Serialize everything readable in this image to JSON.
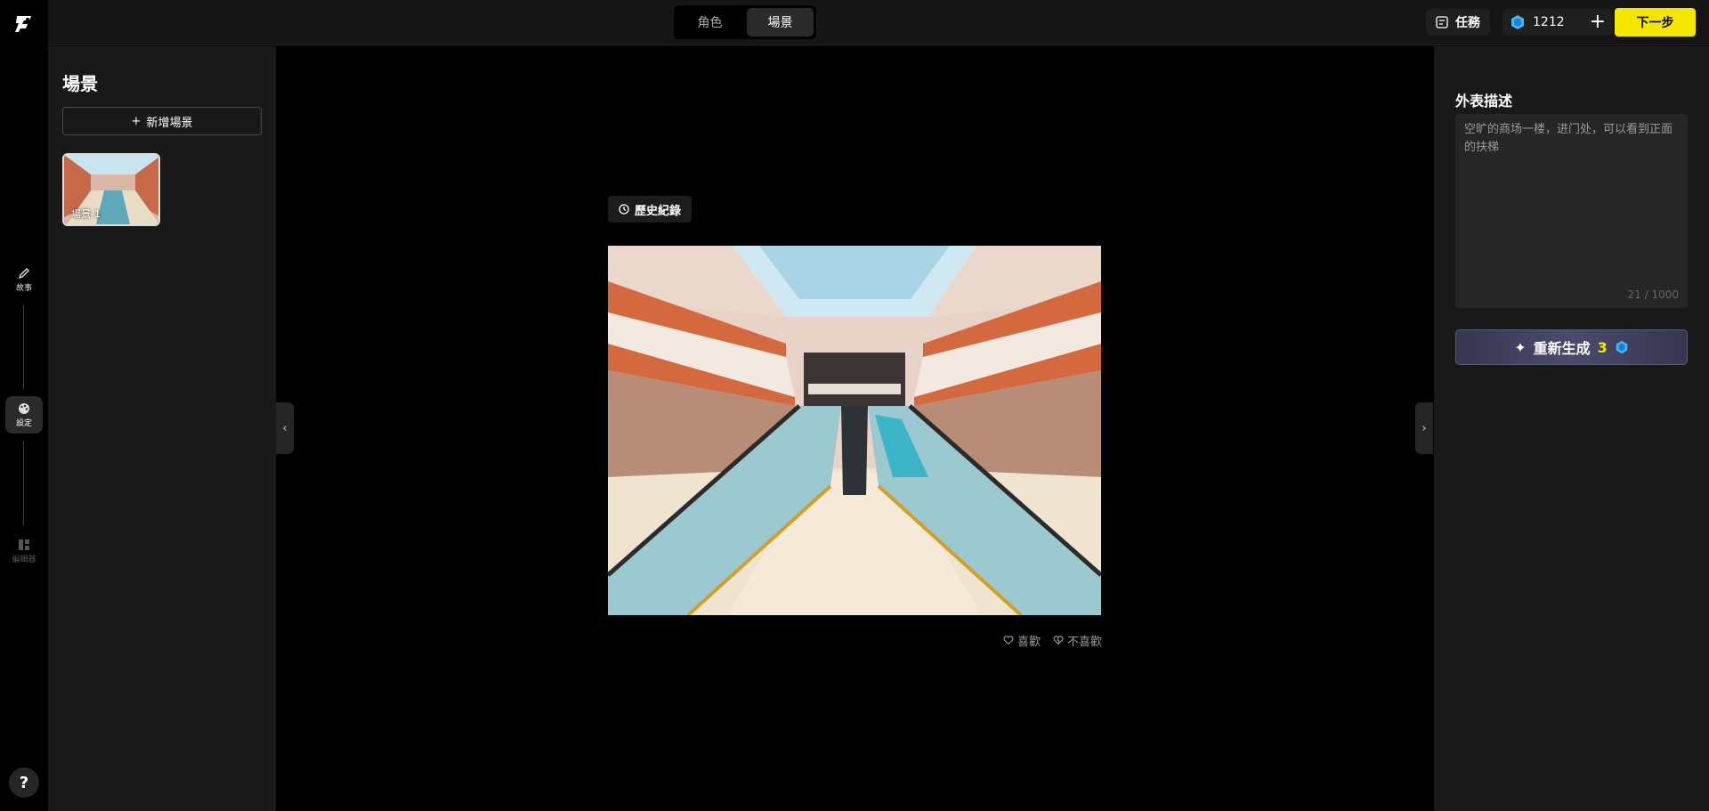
{
  "rail": {
    "items": [
      {
        "label": "故事"
      },
      {
        "label": "設定"
      },
      {
        "label": "編輯器"
      }
    ],
    "help": "?"
  },
  "topbar": {
    "tabs": [
      {
        "label": "角色"
      },
      {
        "label": "場景"
      }
    ],
    "task_label": "任務",
    "credits": "1212",
    "next_label": "下一步"
  },
  "left_panel": {
    "title": "場景",
    "add_label": "新增場景",
    "scenes": [
      {
        "label": "場景-1"
      }
    ]
  },
  "canvas": {
    "history_label": "歷史紀錄",
    "like_label": "喜歡",
    "dislike_label": "不喜歡"
  },
  "right_panel": {
    "title": "外表描述",
    "description": "空旷的商场一楼，进门处，可以看到正面的扶梯",
    "char_count": "21 / 1000",
    "regen_label": "重新生成",
    "regen_cost": "3"
  },
  "colors": {
    "accent_yellow": "#f5e600",
    "panel_bg": "#191919",
    "gem": "#3fb8ff"
  }
}
